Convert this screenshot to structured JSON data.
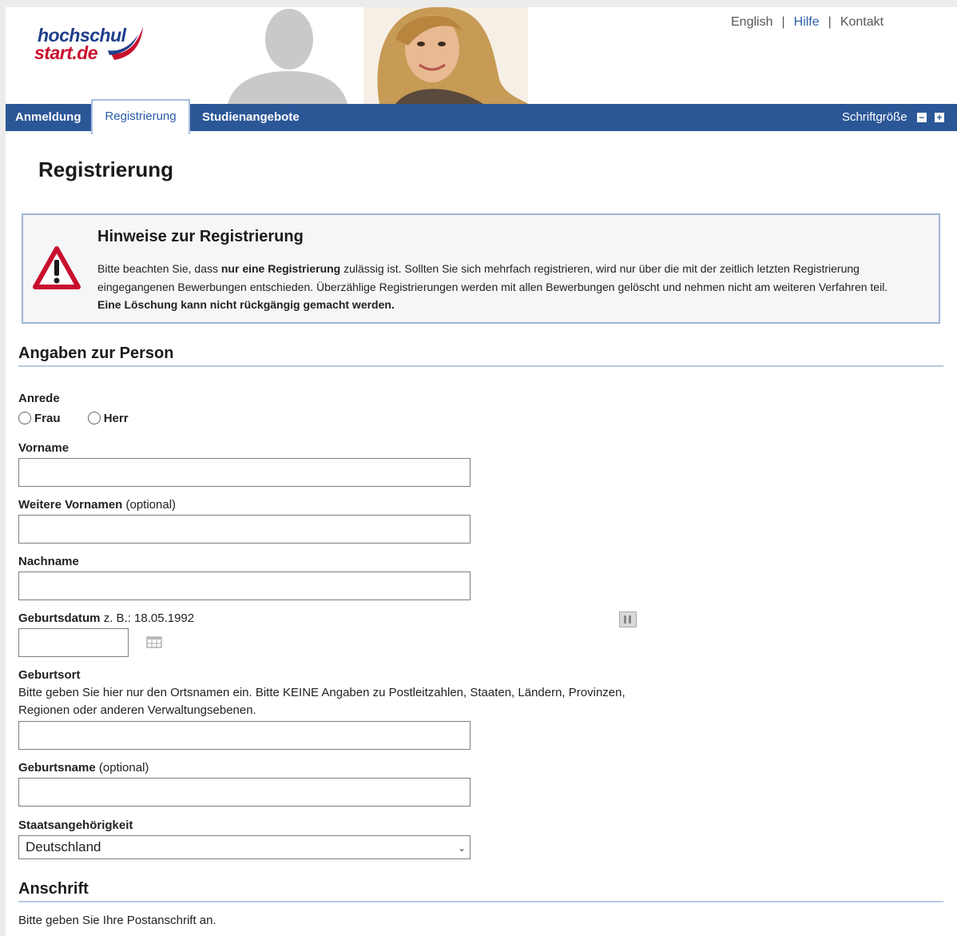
{
  "brand": {
    "logo_line1": "hochschul",
    "logo_line2": "start.de"
  },
  "toplinks": {
    "english": "English",
    "help": "Hilfe",
    "contact": "Kontakt",
    "separator": "|"
  },
  "nav": {
    "items": [
      "Anmeldung",
      "Registrierung",
      "Studienangebote"
    ],
    "font_size_label": "Schriftgröße",
    "font_smaller": "−",
    "font_larger": "+"
  },
  "page": {
    "title": "Registrierung"
  },
  "notice": {
    "title": "Hinweise zur Registrierung",
    "text_1": "Bitte beachten Sie, dass ",
    "text_bold_1": "nur eine Registrierung",
    "text_2": " zulässig ist. Sollten Sie sich mehrfach registrieren, wird nur über die mit der zeitlich letzten Registrierung eingegangenen Bewerbungen entschieden. Überzählige Registrierungen werden mit allen Bewerbungen gelöscht und nehmen nicht am weiteren Verfahren teil. ",
    "text_bold_2": "Eine Löschung kann nicht rückgängig gemacht werden."
  },
  "person": {
    "section_title": "Angaben zur Person",
    "salutation_label": "Anrede",
    "salutation_options": [
      "Frau",
      "Herr"
    ],
    "firstname_label": "Vorname",
    "more_firstnames_label": "Weitere Vornamen",
    "optional_hint": "(optional)",
    "lastname_label": "Nachname",
    "birthdate_label": "Geburtsdatum",
    "birthdate_hint": "z. B.: 18.05.1992",
    "birthplace_label": "Geburtsort",
    "birthplace_help": "Bitte geben Sie hier nur den Ortsnamen ein. Bitte KEINE Angaben zu Postleitzahlen, Staaten, Ländern, Provinzen, Regionen oder anderen Verwaltungsebenen.",
    "birthname_label": "Geburtsname",
    "nationality_label": "Staatsangehörigkeit",
    "nationality_value": "Deutschland"
  },
  "address": {
    "section_title": "Anschrift",
    "help": "Bitte geben Sie Ihre Postanschrift an."
  },
  "colors": {
    "nav_blue": "#2b5797",
    "link_blue": "#2a5ea8",
    "brand_red": "#c8102e",
    "brand_navy": "#1f3f8c"
  }
}
